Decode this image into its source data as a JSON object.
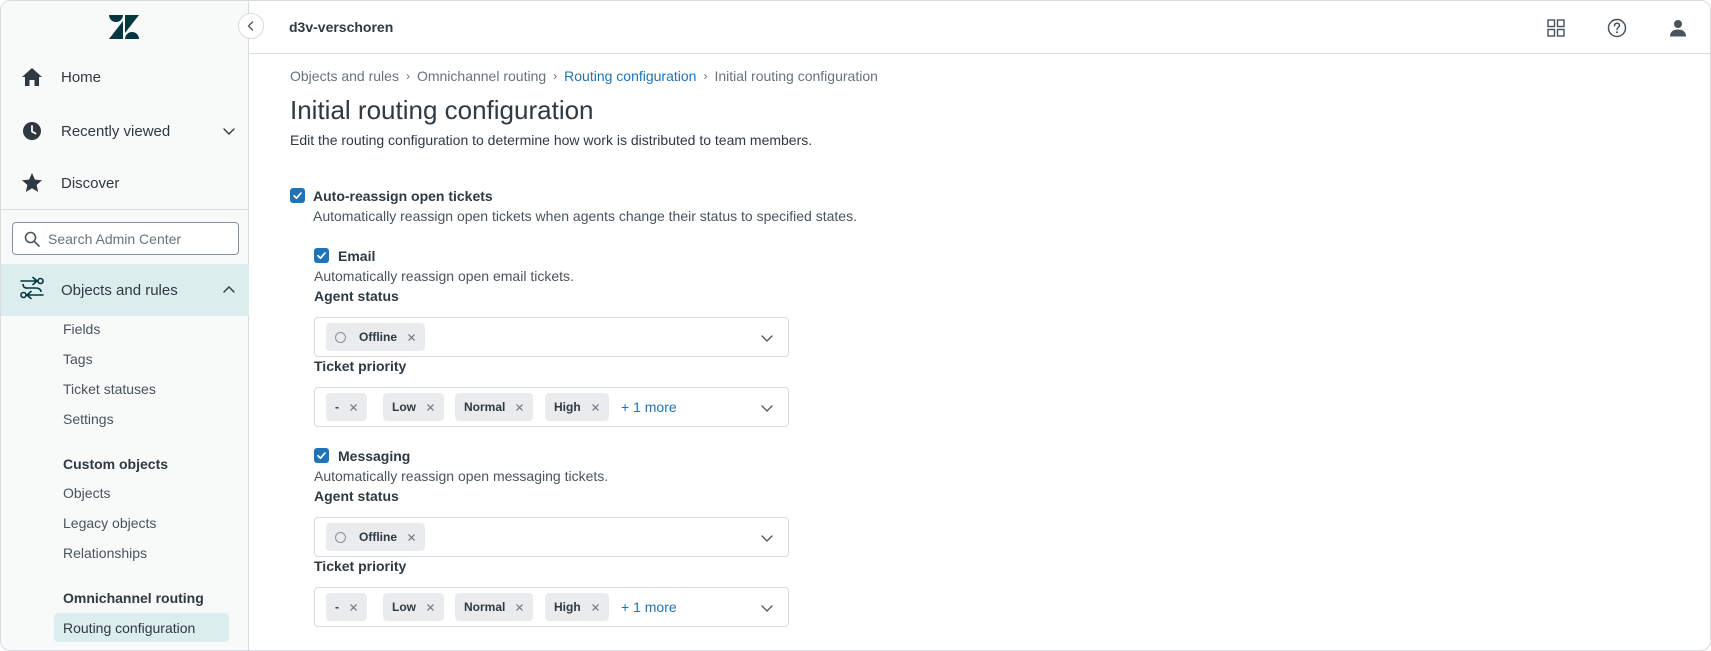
{
  "app": {
    "workspace": "d3v-verschoren"
  },
  "sidebar": {
    "nav": [
      {
        "label": "Home",
        "icon": "home-icon"
      },
      {
        "label": "Recently viewed",
        "icon": "clock-icon"
      },
      {
        "label": "Discover",
        "icon": "star-icon"
      }
    ],
    "search_placeholder": "Search Admin Center",
    "section": {
      "label": "Objects and rules",
      "icon": "objects-rules-icon"
    },
    "items": [
      "Fields",
      "Tags",
      "Ticket statuses",
      "Settings"
    ],
    "custom_objects": {
      "heading": "Custom objects",
      "items": [
        "Objects",
        "Legacy objects",
        "Relationships"
      ]
    },
    "omnichannel": {
      "heading": "Omnichannel routing",
      "active": "Routing configuration"
    }
  },
  "breadcrumb": [
    "Objects and rules",
    "Omnichannel routing",
    "Routing configuration",
    "Initial routing configuration"
  ],
  "page": {
    "title": "Initial routing configuration",
    "description": "Edit the routing configuration to determine how work is distributed to team members."
  },
  "auto_reassign": {
    "label": "Auto-reassign open tickets",
    "checked": true,
    "hint": "Automatically reassign open tickets when agents change their status to specified states.",
    "channels": [
      {
        "label": "Email",
        "checked": true,
        "hint": "Automatically reassign open email tickets.",
        "agent_status_label": "Agent status",
        "agent_status_tags": [
          "Offline"
        ],
        "priority_label": "Ticket priority",
        "priority_tags": [
          "-",
          "Low",
          "Normal",
          "High"
        ],
        "more": "+ 1 more"
      },
      {
        "label": "Messaging",
        "checked": true,
        "hint": "Automatically reassign open messaging tickets.",
        "agent_status_label": "Agent status",
        "agent_status_tags": [
          "Offline"
        ],
        "priority_label": "Ticket priority",
        "priority_tags": [
          "-",
          "Low",
          "Normal",
          "High"
        ],
        "more": "+ 1 more"
      }
    ]
  },
  "colors": {
    "accent": "#1f73b7",
    "active_bg": "#dcedee",
    "text": "#2f3941"
  }
}
